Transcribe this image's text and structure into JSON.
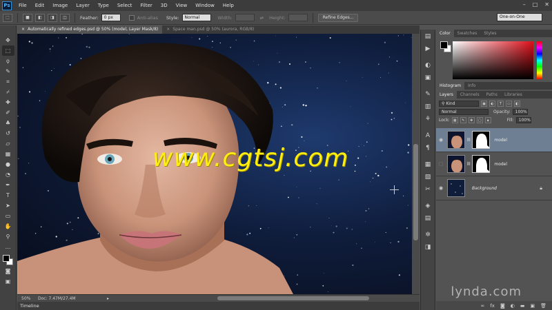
{
  "app": {
    "logo": "Ps",
    "menu": [
      "File",
      "Edit",
      "Image",
      "Layer",
      "Type",
      "Select",
      "Filter",
      "3D",
      "View",
      "Window",
      "Help"
    ],
    "window_controls": [
      "–",
      "□",
      "✕"
    ]
  },
  "options_bar": {
    "feather_label": "Feather:",
    "feather_value": "0 px",
    "antialias_label": "Anti-alias",
    "style_label": "Style:",
    "style_value": "Normal",
    "width_label": "Width:",
    "height_label": "Height:",
    "refine_edges_button": "Refine Edges...",
    "workspace": "One-on-One"
  },
  "tabs": [
    {
      "label": "Automatically refined edges.psd @ 50% (model, Layer Mask/8)",
      "active": true
    },
    {
      "label": "Space man.psd @ 50% (aurora, RGB/8)",
      "active": false
    }
  ],
  "canvas": {
    "watermark": "www.cgtsj.com"
  },
  "status": {
    "zoom": "50%",
    "doc": "Doc: 7.47M/27.4M"
  },
  "timeline": "Timeline",
  "panels": {
    "color_tabs": [
      "Color",
      "Swatches",
      "Styles"
    ],
    "histogram_tabs": [
      "Histogram",
      "Info"
    ],
    "layers_tabs": [
      "Layers",
      "Channels",
      "Paths",
      "Libraries"
    ],
    "filter_kind": "Kind",
    "blend_mode": "Normal",
    "opacity_label": "Opacity:",
    "opacity_value": "100%",
    "lock_label": "Lock:",
    "fill_label": "Fill:",
    "fill_value": "100%",
    "layers": [
      {
        "name": "model",
        "selected": true,
        "visible": true,
        "has_mask": true
      },
      {
        "name": "model",
        "selected": false,
        "visible": false,
        "has_mask": true
      },
      {
        "name": "Background",
        "selected": false,
        "visible": true,
        "has_mask": false,
        "locked": true
      }
    ]
  },
  "brand_watermark": "lynda.com"
}
